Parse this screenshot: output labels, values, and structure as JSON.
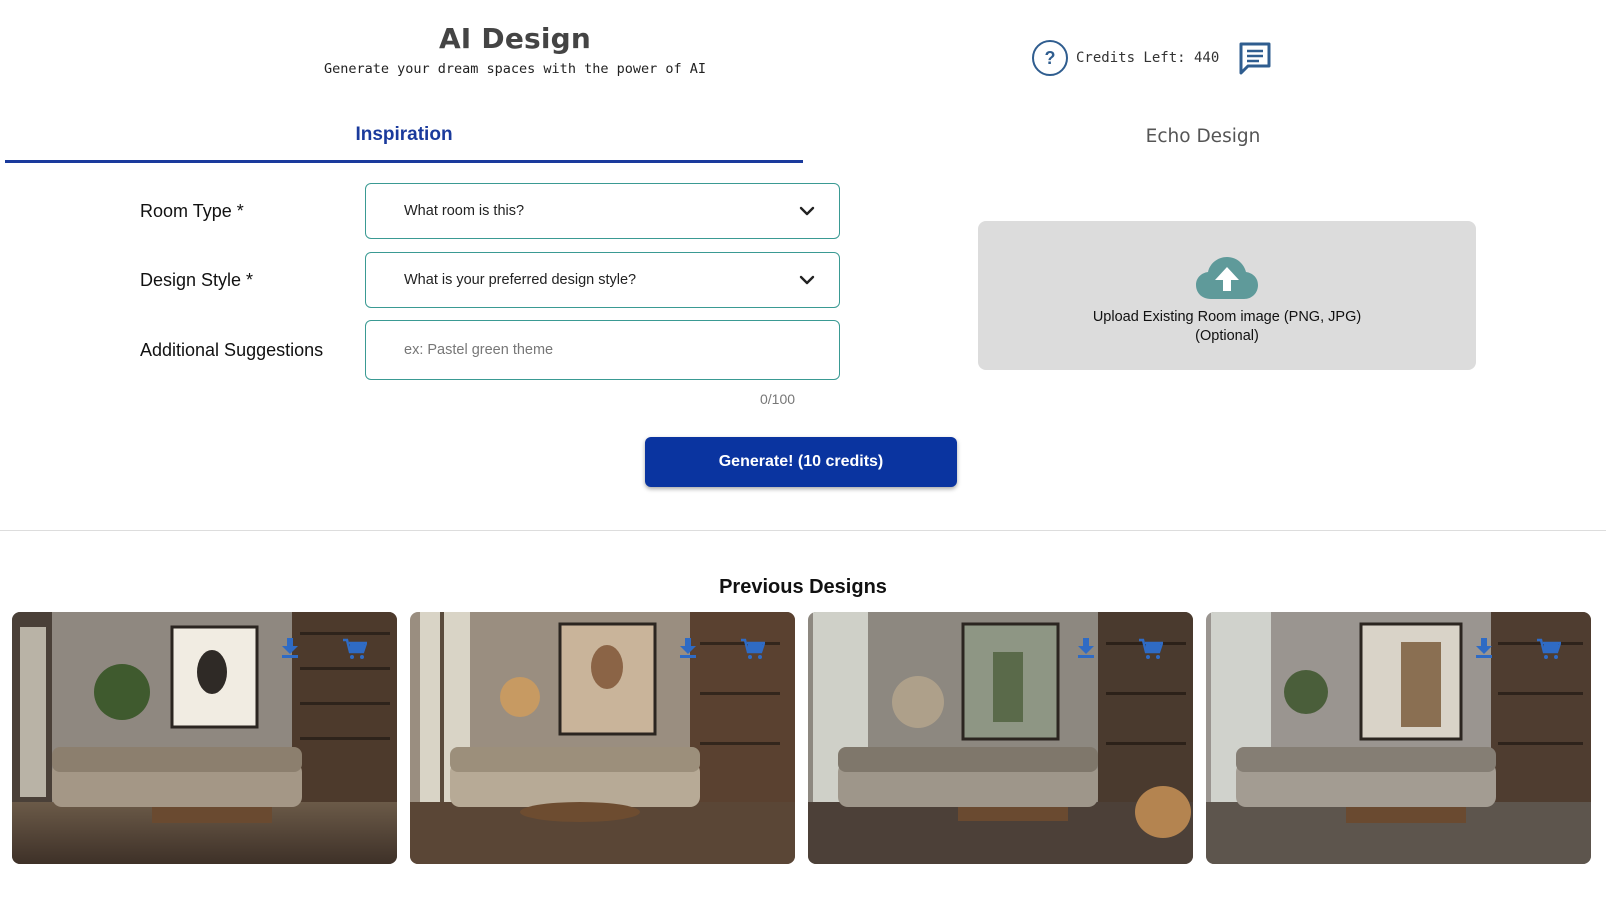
{
  "header": {
    "title": "AI Design",
    "subtitle": "Generate your dream spaces with the power of AI",
    "help_icon": "?",
    "credits_text": "Credits Left: 440"
  },
  "tabs": [
    {
      "label": "Inspiration",
      "active": true
    },
    {
      "label": "Echo Design",
      "active": false
    }
  ],
  "form": {
    "room_type": {
      "label": "Room Type *",
      "value": "What room is this?"
    },
    "design_style": {
      "label": "Design Style *",
      "value": "What is your preferred design style?"
    },
    "suggestions": {
      "label": "Additional Suggestions",
      "placeholder": "ex: Pastel green theme",
      "counter": "0/100"
    },
    "generate_label": "Generate! (10 credits)"
  },
  "upload": {
    "title": "Upload Existing Room image (PNG, JPG)",
    "optional": "(Optional)"
  },
  "gallery": {
    "title": "Previous Designs",
    "items": [
      {
        "alt": "Living room with portrait artwork"
      },
      {
        "alt": "Living room with woman portrait"
      },
      {
        "alt": "Living room with forest painting and pendant lamp"
      },
      {
        "alt": "Living room with abstract painting"
      }
    ]
  },
  "colors": {
    "accent": "#0a34a0",
    "tab_active": "#1a3a9c",
    "field_border": "#3a9a93",
    "upload_bg": "#dcdcdc",
    "upload_icon": "#5f9a9a",
    "icon_blue": "#2f5d8f"
  }
}
